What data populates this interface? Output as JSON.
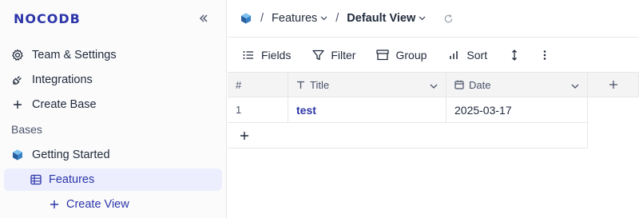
{
  "sidebar": {
    "logo": "NOCODB",
    "collapse_icon": "chevrons-left-icon",
    "items": [
      {
        "label": "Team & Settings",
        "icon": "gear-icon"
      },
      {
        "label": "Integrations",
        "icon": "plug-icon"
      },
      {
        "label": "Create Base",
        "icon": "plus-icon"
      }
    ],
    "bases_label": "Bases",
    "base": {
      "label": "Getting Started",
      "icon": "cube-icon"
    },
    "table": {
      "label": "Features",
      "icon": "grid-icon"
    },
    "create_view": {
      "label": "Create View",
      "icon": "plus-icon"
    }
  },
  "header": {
    "table_name": "Features",
    "view_name": "Default View",
    "separator": "/"
  },
  "toolbar": {
    "fields": "Fields",
    "filter": "Filter",
    "group": "Group",
    "sort": "Sort"
  },
  "grid": {
    "columns": [
      {
        "label": "#"
      },
      {
        "label": "Title",
        "icon": "text-icon"
      },
      {
        "label": "Date",
        "icon": "calendar-icon"
      }
    ],
    "rows": [
      {
        "index": "1",
        "title": "test",
        "date": "2025-03-17"
      }
    ]
  },
  "colors": {
    "accent": "#2b35a8",
    "active_bg": "#eceefd",
    "header_bg": "#f4f4f5",
    "border": "#e7e7e9"
  }
}
